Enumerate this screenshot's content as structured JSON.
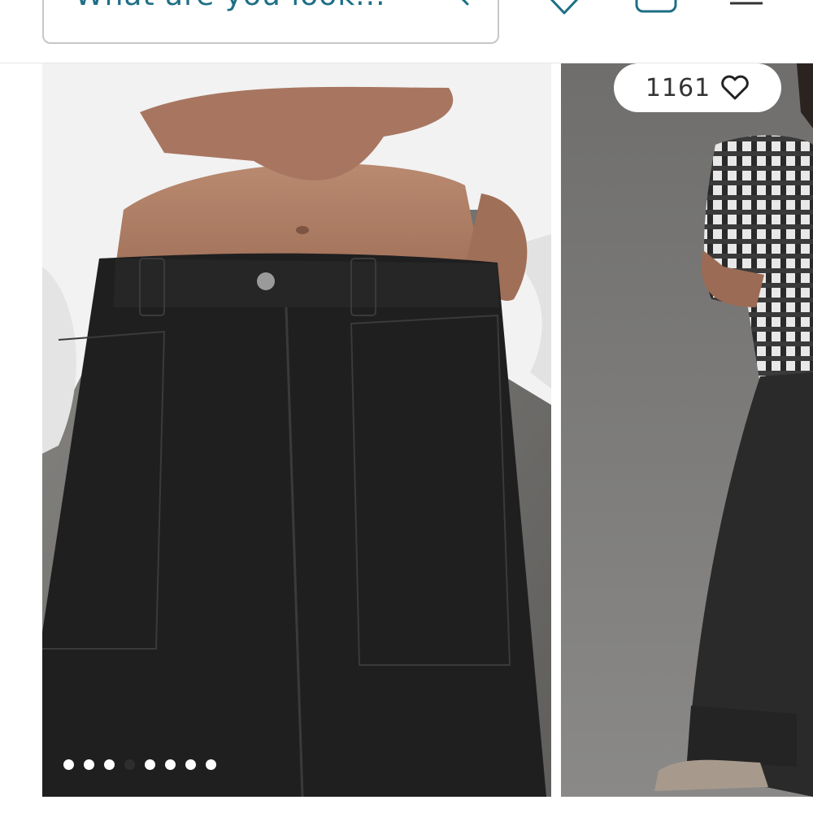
{
  "search": {
    "placeholder": "What are you look..."
  },
  "header": {
    "icons": [
      "search-icon",
      "heart-icon",
      "bag-icon",
      "menu-icon"
    ]
  },
  "products": [
    {
      "image": "model in white blouse wearing black high-rise jeans with patch pockets (close-up)",
      "carousel_dots": 8,
      "active_dot": 4
    },
    {
      "image": "model in plaid shirt wearing black wide-leg jeans and ankle boots",
      "likes": "1161"
    }
  ],
  "colors": {
    "accent": "#1d6f86",
    "denim": "#1f1f20",
    "background": "#7a7977"
  }
}
